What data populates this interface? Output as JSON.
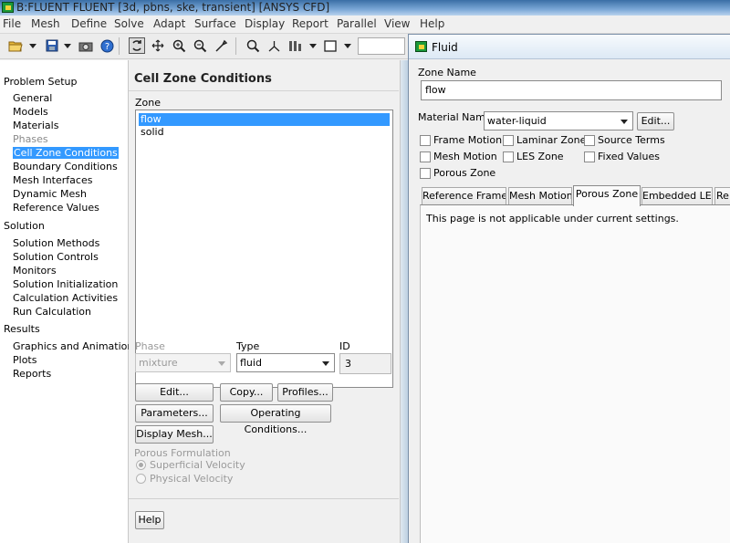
{
  "window": {
    "title": "B:FLUENT FLUENT  [3d, pbns, ske, transient] [ANSYS CFD]"
  },
  "menu": [
    "File",
    "Mesh",
    "Define",
    "Solve",
    "Adapt",
    "Surface",
    "Display",
    "Report",
    "Parallel",
    "View",
    "Help"
  ],
  "toolbar": {
    "icons": [
      "open-folder-icon",
      "save-icon",
      "camera-icon",
      "help-icon",
      "rotate-icon",
      "pan-icon",
      "zoom-in-icon",
      "zoom-box-icon",
      "probe-icon",
      "fit-icon",
      "axes-icon",
      "layout-icon",
      "window-icon"
    ]
  },
  "nav": {
    "problem_setup": "Problem Setup",
    "general": "General",
    "models": "Models",
    "materials": "Materials",
    "phases": "Phases",
    "cell_zone_conditions": "Cell Zone Conditions",
    "boundary_conditions": "Boundary Conditions",
    "mesh_interfaces": "Mesh Interfaces",
    "dynamic_mesh": "Dynamic Mesh",
    "reference_values": "Reference Values",
    "solution": "Solution",
    "solution_methods": "Solution Methods",
    "solution_controls": "Solution Controls",
    "monitors": "Monitors",
    "solution_initialization": "Solution Initialization",
    "calculation_activities": "Calculation Activities",
    "run_calculation": "Run Calculation",
    "results": "Results",
    "graphics_and_animations": "Graphics and Animations",
    "plots": "Plots",
    "reports": "Reports"
  },
  "center": {
    "title": "Cell Zone Conditions",
    "zone_label": "Zone",
    "zones": [
      "flow",
      "solid"
    ],
    "phase_label": "Phase",
    "phase_value": "mixture",
    "type_label": "Type",
    "type_value": "fluid",
    "id_label": "ID",
    "id_value": "3",
    "edit_button": "Edit...",
    "copy_button": "Copy...",
    "profiles_button": "Profiles...",
    "parameters_button": "Parameters...",
    "operating_conditions_button": "Operating Conditions...",
    "display_mesh_button": "Display Mesh...",
    "porous_formulation_label": "Porous Formulation",
    "superficial_velocity": "Superficial Velocity",
    "physical_velocity": "Physical Velocity",
    "help_button": "Help"
  },
  "dialog": {
    "title": "Fluid",
    "zone_name_label": "Zone Name",
    "zone_name_value": "flow",
    "material_name_label": "Material Name",
    "material_value": "water-liquid",
    "edit_button": "Edit...",
    "checkboxes": {
      "frame_motion": "Frame Motion",
      "laminar_zone": "Laminar Zone",
      "source_terms": "Source Terms",
      "mesh_motion": "Mesh Motion",
      "les_zone": "LES Zone",
      "fixed_values": "Fixed Values",
      "porous_zone": "Porous Zone"
    },
    "tabs": {
      "reference_frame": "Reference Frame",
      "mesh_motion": "Mesh Motion",
      "porous_zone": "Porous Zone",
      "embedded_les": "Embedded LES",
      "re": "Re"
    },
    "tab_message": "This page is not applicable under current settings."
  }
}
